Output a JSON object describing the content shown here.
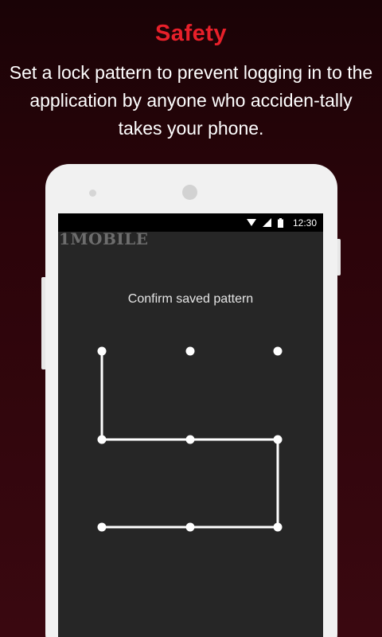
{
  "hero": {
    "title": "Safety",
    "description": "Set a lock pattern to prevent logging in to the application  by anyone who acciden-tally takes your phone."
  },
  "status_bar": {
    "time": "12:30",
    "icons": [
      "wifi-icon",
      "signal-icon",
      "battery-icon"
    ]
  },
  "watermark": {
    "brand": "1MOBILE"
  },
  "lock_screen": {
    "prompt": "Confirm saved pattern",
    "pattern_sequence": [
      1,
      4,
      5,
      6,
      9,
      8,
      7
    ]
  },
  "colors": {
    "accent": "#e8202a",
    "background_dark": "#1a0306",
    "screen_bg": "#262626",
    "pattern_line": "#ffffff"
  }
}
